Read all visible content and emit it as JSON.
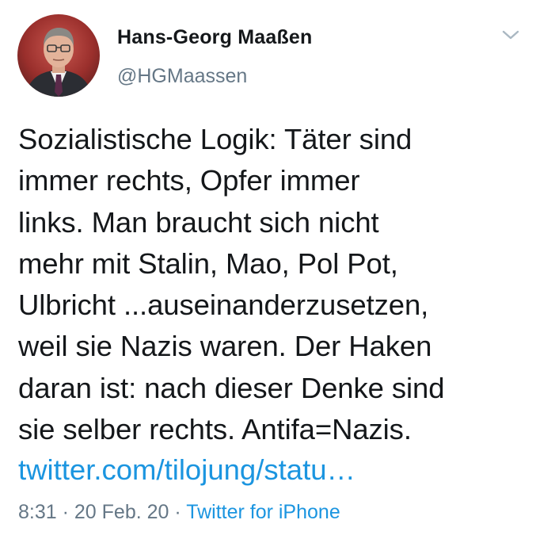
{
  "author": {
    "display_name": "Hans-Georg Maaßen",
    "handle": "@HGMaassen",
    "avatar_icon": "profile-photo"
  },
  "menu_icon": "chevron-down-icon",
  "tweet": {
    "lines": [
      "Sozialistische Logik: Täter sind",
      "immer rechts, Opfer immer",
      "links. Man braucht sich nicht",
      "mehr mit Stalin, Mao, Pol Pot,",
      "Ulbricht ...auseinanderzusetzen,",
      "weil sie Nazis waren. Der Haken",
      "daran ist: nach dieser Denke sind",
      "sie selber rechts. Antifa=Nazis."
    ],
    "link": "twitter.com/tilojung/statu…"
  },
  "meta": {
    "time": "8:31",
    "separator": " · ",
    "date": "20 Feb. 20",
    "source": "Twitter for iPhone"
  },
  "colors": {
    "text": "#14171a",
    "secondary": "#657786",
    "link": "#1b95e0",
    "background": "#ffffff"
  }
}
